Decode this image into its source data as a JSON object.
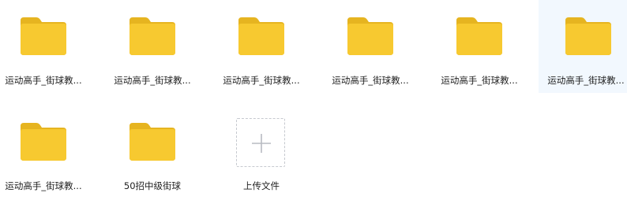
{
  "icons": {
    "folder": "folder-icon",
    "upload": "plus-icon"
  },
  "colors": {
    "folder_back": "#E6B420",
    "folder_front": "#F7C930",
    "selected_bg": "#F2F8FE",
    "upload_border": "#C6C9CF"
  },
  "items": [
    {
      "type": "folder",
      "label": "运动高手_街球教..."
    },
    {
      "type": "folder",
      "label": "运动高手_街球教..."
    },
    {
      "type": "folder",
      "label": "运动高手_街球教..."
    },
    {
      "type": "folder",
      "label": "运动高手_街球教..."
    },
    {
      "type": "folder",
      "label": "运动高手_街球教..."
    },
    {
      "type": "folder",
      "label": "运动高手_街球教...",
      "selected": true
    },
    {
      "type": "folder",
      "label": "运动高手_街球教..."
    },
    {
      "type": "folder",
      "label": "50招中级街球"
    }
  ],
  "upload": {
    "label": "上传文件"
  }
}
